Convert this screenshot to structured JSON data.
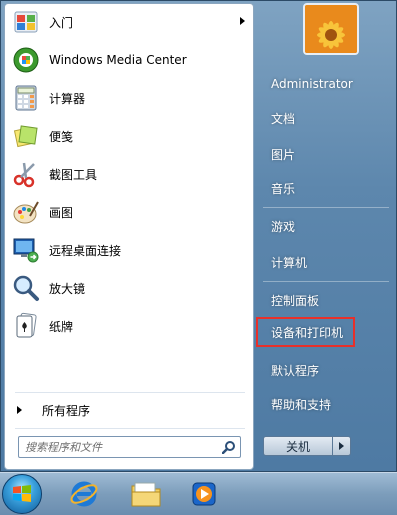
{
  "left_pane": {
    "programs": [
      {
        "label": "入门",
        "icon": "getting-started-icon",
        "has_submenu": true
      },
      {
        "label": "Windows Media Center",
        "icon": "windows-media-center-icon"
      },
      {
        "label": "计算器",
        "icon": "calculator-icon"
      },
      {
        "label": "便笺",
        "icon": "sticky-notes-icon"
      },
      {
        "label": "截图工具",
        "icon": "snipping-tool-icon"
      },
      {
        "label": "画图",
        "icon": "paint-icon"
      },
      {
        "label": "远程桌面连接",
        "icon": "remote-desktop-icon"
      },
      {
        "label": "放大镜",
        "icon": "magnifier-icon"
      },
      {
        "label": "纸牌",
        "icon": "solitaire-icon"
      }
    ],
    "all_programs_label": "所有程序",
    "search": {
      "placeholder": "搜索程序和文件",
      "icon": "search-icon"
    }
  },
  "right_pane": {
    "user_picture": "user-avatar-flower",
    "items": [
      {
        "label": "Administrator"
      },
      {
        "label": "文档"
      },
      {
        "label": "图片"
      },
      {
        "label": "音乐"
      },
      {
        "label": "游戏"
      },
      {
        "label": "计算机"
      },
      {
        "label": "控制面板"
      },
      {
        "label": "设备和打印机",
        "highlighted": true
      },
      {
        "label": "默认程序"
      },
      {
        "label": "帮助和支持"
      }
    ],
    "shutdown_label": "关机",
    "highlight_color": "#e8302a"
  },
  "taskbar": {
    "items": [
      {
        "icon": "start-orb-icon"
      },
      {
        "icon": "internet-explorer-icon"
      },
      {
        "icon": "windows-explorer-icon"
      },
      {
        "icon": "media-player-icon"
      }
    ]
  }
}
